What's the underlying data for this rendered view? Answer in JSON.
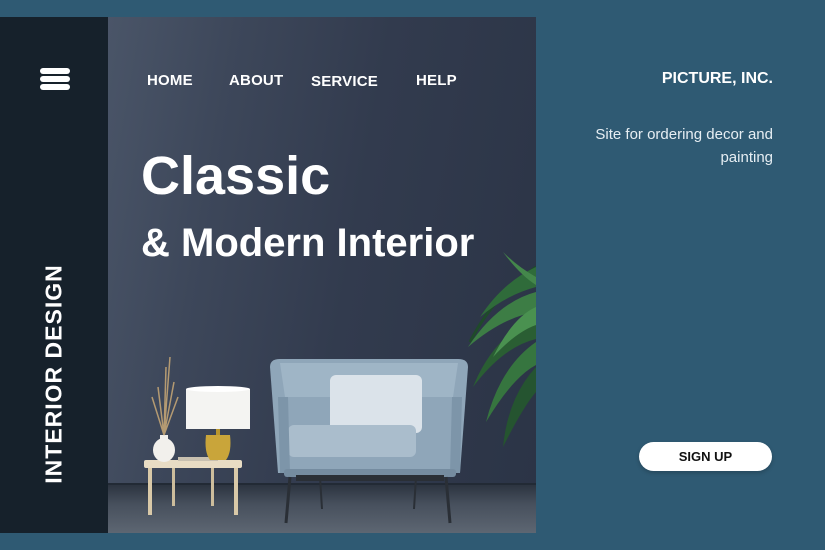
{
  "sidebar": {
    "menu_icon": "hamburger-menu-icon",
    "vertical_title": "INTERIOR DESIGN"
  },
  "nav": {
    "items": [
      {
        "label": "HOME"
      },
      {
        "label": "ABOUT"
      },
      {
        "label": "SERVICE"
      },
      {
        "label": "HELP"
      }
    ]
  },
  "hero": {
    "headline_line1": "Classic",
    "headline_line2": "& Modern Interior"
  },
  "info": {
    "company": "PICTURE, INC.",
    "tagline": "Site for ordering decor and painting",
    "signup_label": "SIGN UP"
  },
  "colors": {
    "background": "#2f5a73",
    "sidebar": "#16212b",
    "hero_wall": "#323b4e",
    "text": "#ffffff"
  }
}
